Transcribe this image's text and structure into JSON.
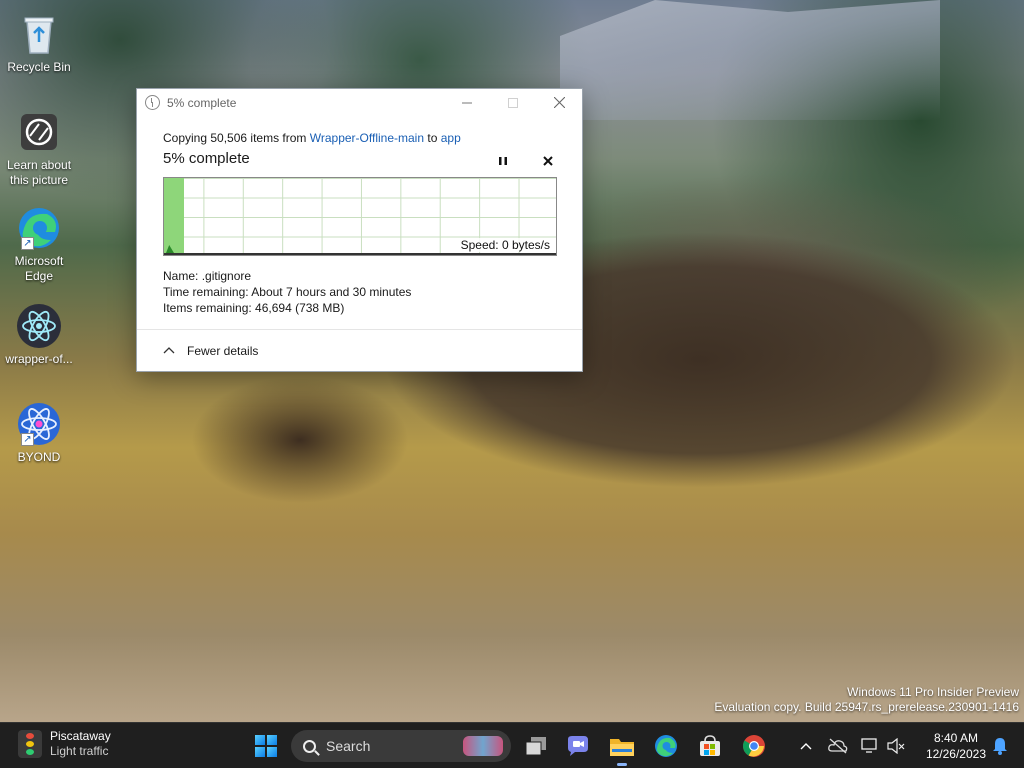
{
  "desktop": {
    "icons": [
      {
        "label": "Recycle Bin",
        "icon": "recycle-bin-icon"
      },
      {
        "label": "Learn about this picture",
        "icon": "camera-icon"
      },
      {
        "label": "Microsoft Edge",
        "icon": "edge-icon"
      },
      {
        "label": "wrapper-of...",
        "icon": "electron-app-icon"
      },
      {
        "label": "BYOND",
        "icon": "byond-icon"
      }
    ],
    "watermark": {
      "line1": "Windows 11 Pro Insider Preview",
      "line2": "Evaluation copy. Build 25947.rs_prerelease.230901-1416"
    }
  },
  "dialog": {
    "title": "5% complete",
    "copy_prefix": "Copying 50,506 items from",
    "source": "Wrapper-Offline-main",
    "copy_to": "to",
    "destination": "app",
    "percent_label": "5% complete",
    "progress": 0.05,
    "speed": "Speed: 0 bytes/s",
    "name_label": "Name:",
    "name_value": ".gitignore",
    "time_label": "Time remaining:",
    "time_value": "About 7 hours and 30 minutes",
    "items_label": "Items remaining:",
    "items_value": "46,694 (738 MB)",
    "fewer_details": "Fewer details",
    "colors": {
      "graph_fill": "#8ed67a",
      "grid": "#c9dfc0",
      "link": "#1a5fb4"
    }
  },
  "taskbar": {
    "weather_city": "Piscataway",
    "weather_status": "Light traffic",
    "search_placeholder": "Search",
    "time": "8:40 AM",
    "date": "12/26/2023"
  }
}
